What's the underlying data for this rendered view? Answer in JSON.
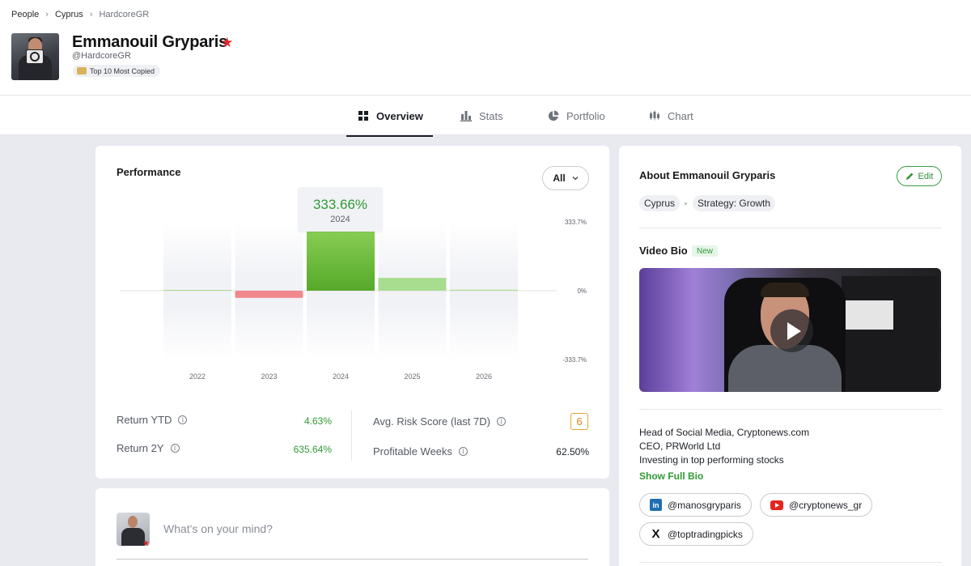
{
  "breadcrumb": [
    "People",
    "Cyprus",
    "HardcoreGR"
  ],
  "profile": {
    "name": "Emmanouil Gryparis",
    "handle": "@HardcoreGR",
    "badge": "Top 10 Most Copied"
  },
  "tabs": [
    {
      "label": "Overview",
      "icon": "grid-icon",
      "active": true
    },
    {
      "label": "Stats",
      "icon": "bar-chart-icon",
      "active": false
    },
    {
      "label": "Portfolio",
      "icon": "pie-chart-icon",
      "active": false
    },
    {
      "label": "Chart",
      "icon": "candlestick-icon",
      "active": false
    }
  ],
  "performance": {
    "title": "Performance",
    "period": "All",
    "tooltip": {
      "value": "333.66%",
      "year": "2024"
    },
    "y_ticks": [
      "333.7%",
      "0%",
      "-333.7%"
    ],
    "stats": [
      {
        "label": "Return YTD",
        "value": "4.63%"
      },
      {
        "label": "Return 2Y",
        "value": "635.64%"
      },
      {
        "label": "Avg. Risk Score (last 7D)",
        "value": "6"
      },
      {
        "label": "Profitable Weeks",
        "value": "62.50%"
      }
    ]
  },
  "chart_data": {
    "type": "bar",
    "categories": [
      "2022",
      "2023",
      "2024",
      "2025",
      "2026"
    ],
    "values": [
      0,
      -35,
      333.66,
      62,
      4.63
    ],
    "ylim": [
      -333.7,
      333.7
    ],
    "colors": {
      "positive": "#6cbf3c",
      "positive_light": "#a8dc8e",
      "negative": "#f0888c"
    },
    "grid": false,
    "ylabel": "",
    "xlabel": ""
  },
  "post": {
    "placeholder": "What's on your mind?"
  },
  "about": {
    "title": "About Emmanouil Gryparis",
    "edit_label": "Edit",
    "chips": [
      "Cyprus",
      "Strategy: Growth"
    ],
    "video_title": "Video Bio",
    "new_label": "New",
    "bio_lines": [
      "Head of Social Media, Cryptonews.com",
      "CEO, PRWorld Ltd",
      "Investing in top performing stocks"
    ],
    "show_bio": "Show Full Bio",
    "socials": [
      {
        "network": "linkedin",
        "handle": "@manosgryparis"
      },
      {
        "network": "youtube",
        "handle": "@cryptonews_gr"
      },
      {
        "network": "x",
        "handle": "@toptradingpicks"
      }
    ]
  },
  "colors": {
    "accent_green": "#2f9a35",
    "brand_red": "#e0242a",
    "risk_orange": "#e2a533"
  }
}
